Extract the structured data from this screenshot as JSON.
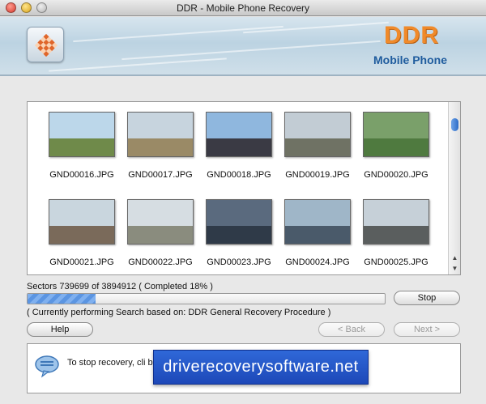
{
  "window": {
    "title": "DDR - Mobile Phone Recovery"
  },
  "banner": {
    "brand": "DDR",
    "subtitle": "Mobile Phone"
  },
  "thumbnails": [
    {
      "file": "GND00016.JPG",
      "sky": "#bcd7ea",
      "ground": "#6f8a4a"
    },
    {
      "file": "GND00017.JPG",
      "sky": "#c7d4de",
      "ground": "#9a8a66"
    },
    {
      "file": "GND00018.JPG",
      "sky": "#8fb7de",
      "ground": "#3a3a44"
    },
    {
      "file": "GND00019.JPG",
      "sky": "#c2ccd4",
      "ground": "#6f7264"
    },
    {
      "file": "GND00020.JPG",
      "sky": "#7aa06a",
      "ground": "#4f7a3f"
    },
    {
      "file": "GND00021.JPG",
      "sky": "#c9d6de",
      "ground": "#7a6a5a"
    },
    {
      "file": "GND00022.JPG",
      "sky": "#d6dde2",
      "ground": "#8a8c7e"
    },
    {
      "file": "GND00023.JPG",
      "sky": "#5a6a7e",
      "ground": "#2f3a48"
    },
    {
      "file": "GND00024.JPG",
      "sky": "#9fb6c8",
      "ground": "#4a5a6a"
    },
    {
      "file": "GND00025.JPG",
      "sky": "#c6d0d8",
      "ground": "#5a5e5e"
    }
  ],
  "status": {
    "sectors": "Sectors 739699 of 3894912    ( Completed 18% )",
    "progress_fraction": 0.19,
    "current_operation": "( Currently performing Search based on: DDR General Recovery Procedure )"
  },
  "buttons": {
    "stop": "Stop",
    "help": "Help",
    "back": "< Back",
    "next": "Next >"
  },
  "info": {
    "message": "To stop recovery, cli                                                                                     be completed."
  },
  "watermark": {
    "text": "driverecoverysoftware.net"
  },
  "colors": {
    "brand_orange": "#f08a2a",
    "brand_blue": "#1f5c9e",
    "progress": "#5b95e2",
    "watermark_bg": "#2559c9"
  }
}
